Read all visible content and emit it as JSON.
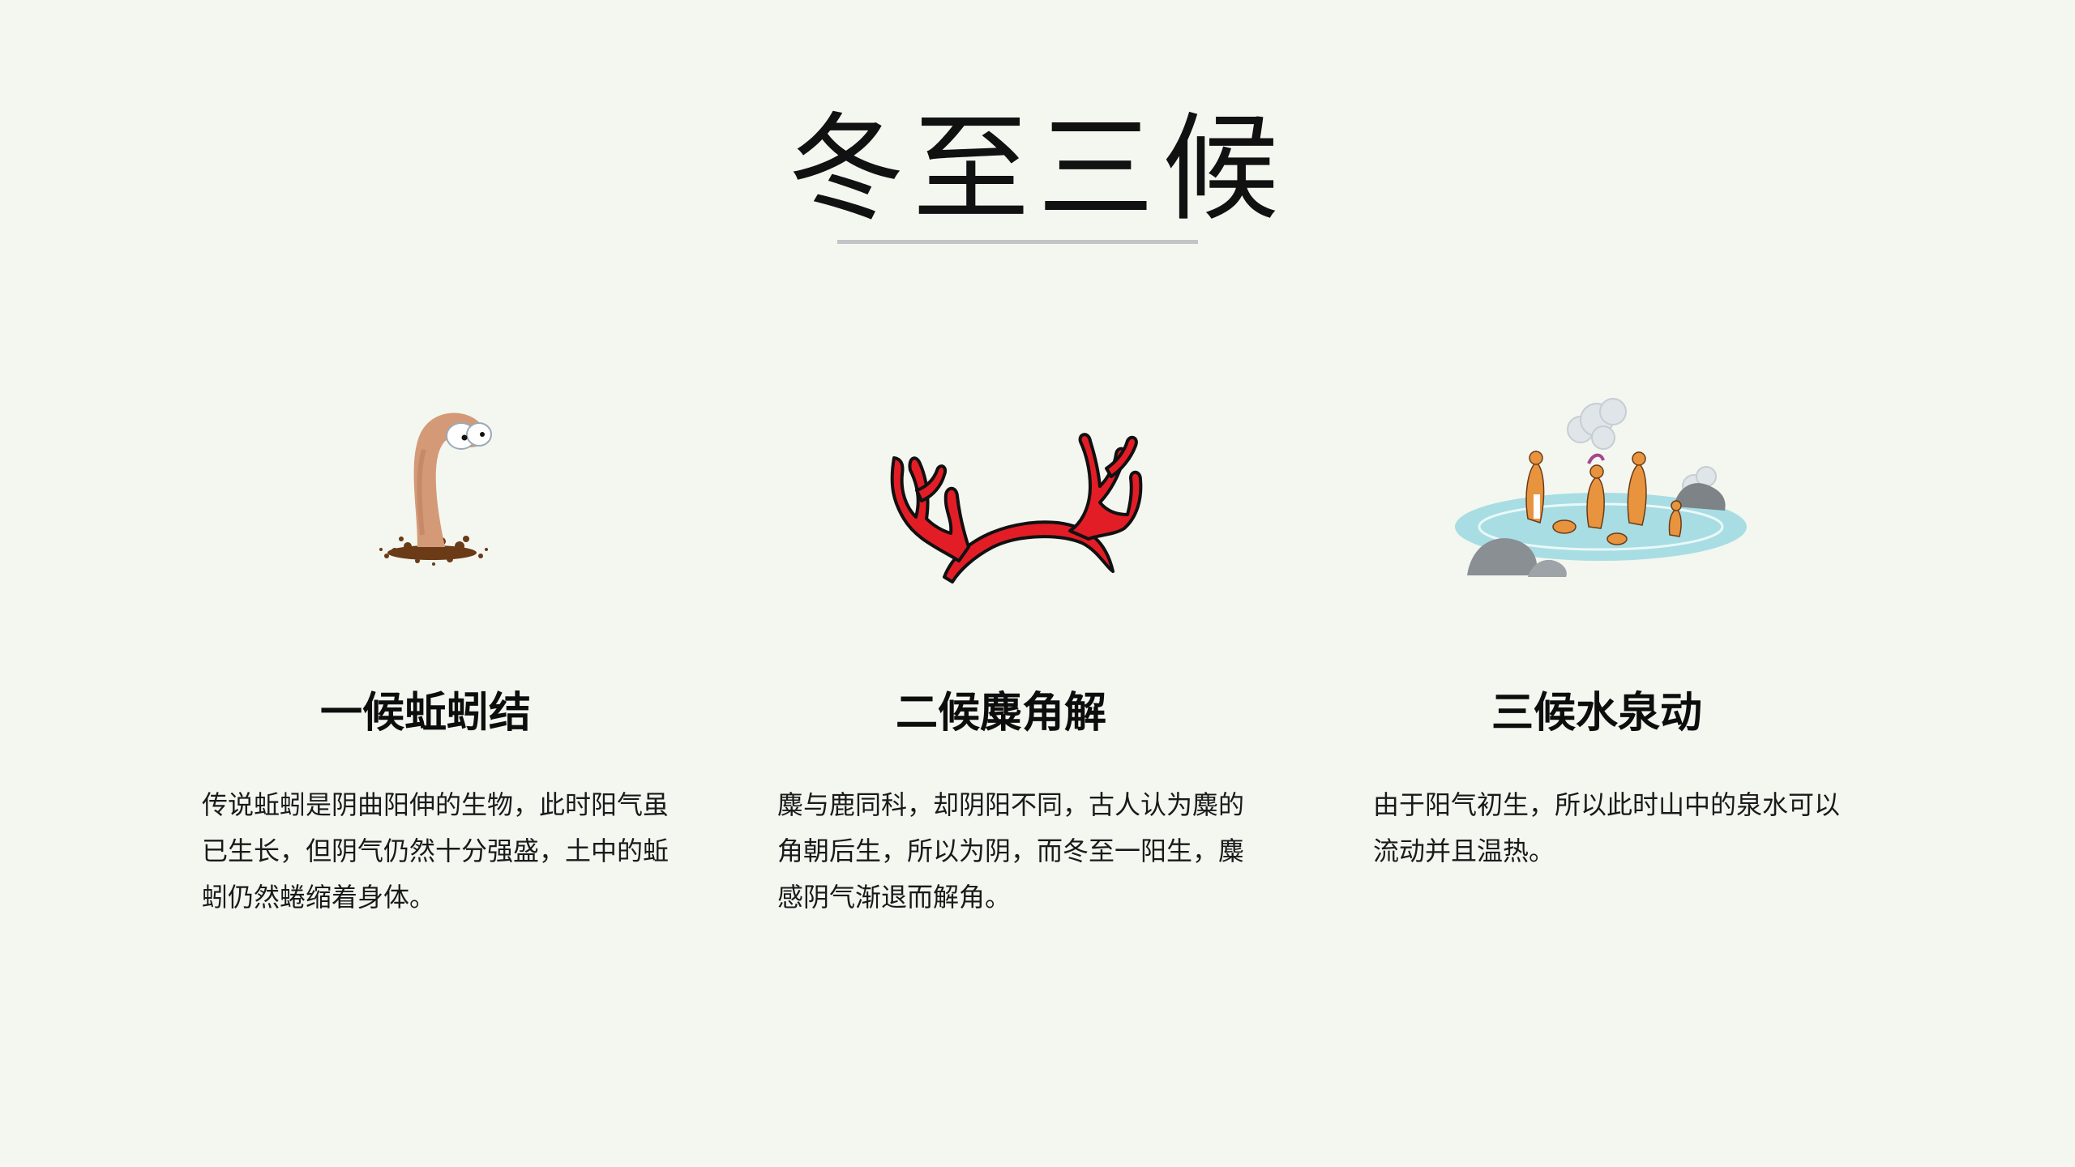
{
  "page": {
    "title": "冬至三候"
  },
  "columns": [
    {
      "icon": "earthworm-icon",
      "heading": "一候蚯蚓结",
      "text": "传说蚯蚓是阴曲阳伸的生物，此时阳气虽已生长，但阴气仍然十分强盛，土中的蚯蚓仍然蜷缩着身体。"
    },
    {
      "icon": "antler-icon",
      "heading": "二候麋角解",
      "text": "麋与鹿同科，却阴阳不同，古人认为麋的角朝后生，所以为阴，而冬至一阳生，麋感阴气渐退而解角。"
    },
    {
      "icon": "hot-spring-icon",
      "heading": "三候水泉动",
      "text": "由于阳气初生，所以此时山中的泉水可以流动并且温热。"
    }
  ],
  "colors": {
    "background": "#f3f7f0",
    "rule": "#c2c4c6",
    "antler": "#e31d26",
    "earthworm": "#d49a78",
    "water": "#a8dde3"
  }
}
